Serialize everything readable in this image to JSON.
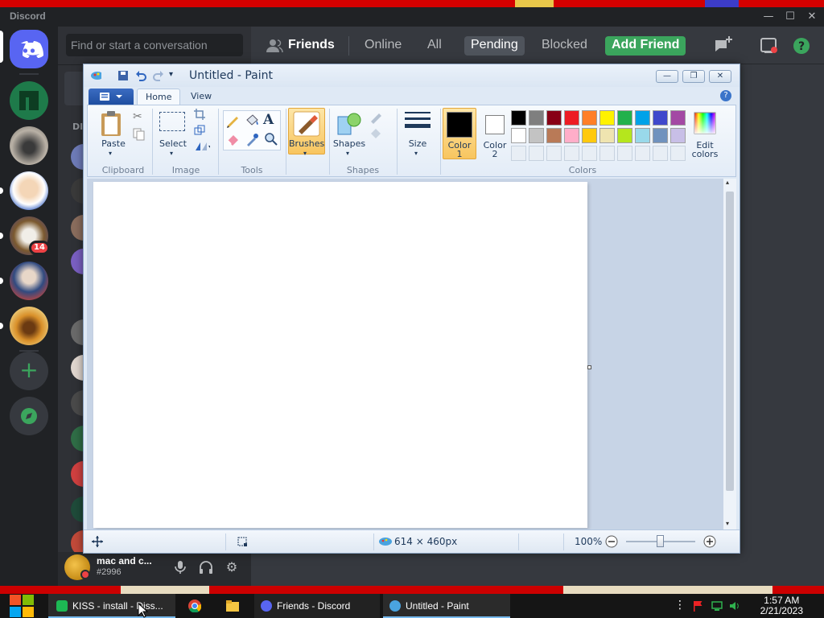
{
  "discord": {
    "app_title": "Discord",
    "search_placeholder": "Find or start a conversation",
    "dm_header": "DI",
    "server_badge": "14",
    "header": {
      "friends": "Friends",
      "online": "Online",
      "all": "All",
      "pending": "Pending",
      "blocked": "Blocked",
      "add_friend": "Add Friend"
    },
    "user": {
      "name": "mac and c...",
      "tag": "#2996"
    },
    "colors": {
      "blurple": "#5865f2",
      "green": "#3ba55d",
      "red": "#ed4245"
    }
  },
  "paint": {
    "title": "Untitled - Paint",
    "tabs": {
      "home": "Home",
      "view": "View"
    },
    "groups": {
      "clipboard": "Clipboard",
      "image": "Image",
      "tools": "Tools",
      "shapes": "Shapes",
      "colors": "Colors"
    },
    "buttons": {
      "paste": "Paste",
      "select": "Select",
      "brushes": "Brushes",
      "shapes": "Shapes",
      "size": "Size",
      "color1_a": "Color",
      "color1_b": "1",
      "color2_a": "Color",
      "color2_b": "2",
      "edit_colors_a": "Edit",
      "edit_colors_b": "colors"
    },
    "palette_row1": [
      "#000000",
      "#7f7f7f",
      "#880015",
      "#ed1c24",
      "#ff7f27",
      "#fff200",
      "#22b14c",
      "#00a2e8",
      "#3f48cc",
      "#a349a4"
    ],
    "palette_row2": [
      "#ffffff",
      "#c3c3c3",
      "#b97a57",
      "#ffaec9",
      "#ffc90e",
      "#efe4b0",
      "#b5e61d",
      "#99d9ea",
      "#7092be",
      "#c8bfe7"
    ],
    "color1": "#000000",
    "color2": "#ffffff",
    "status": {
      "size": "614 × 460px",
      "zoom": "100%"
    }
  },
  "taskbar": {
    "items": {
      "kiss": "KISS - install - Diss...",
      "discord": "Friends - Discord",
      "paint": "Untitled - Paint"
    },
    "time": "1:57 AM",
    "date": "2/21/2023"
  }
}
